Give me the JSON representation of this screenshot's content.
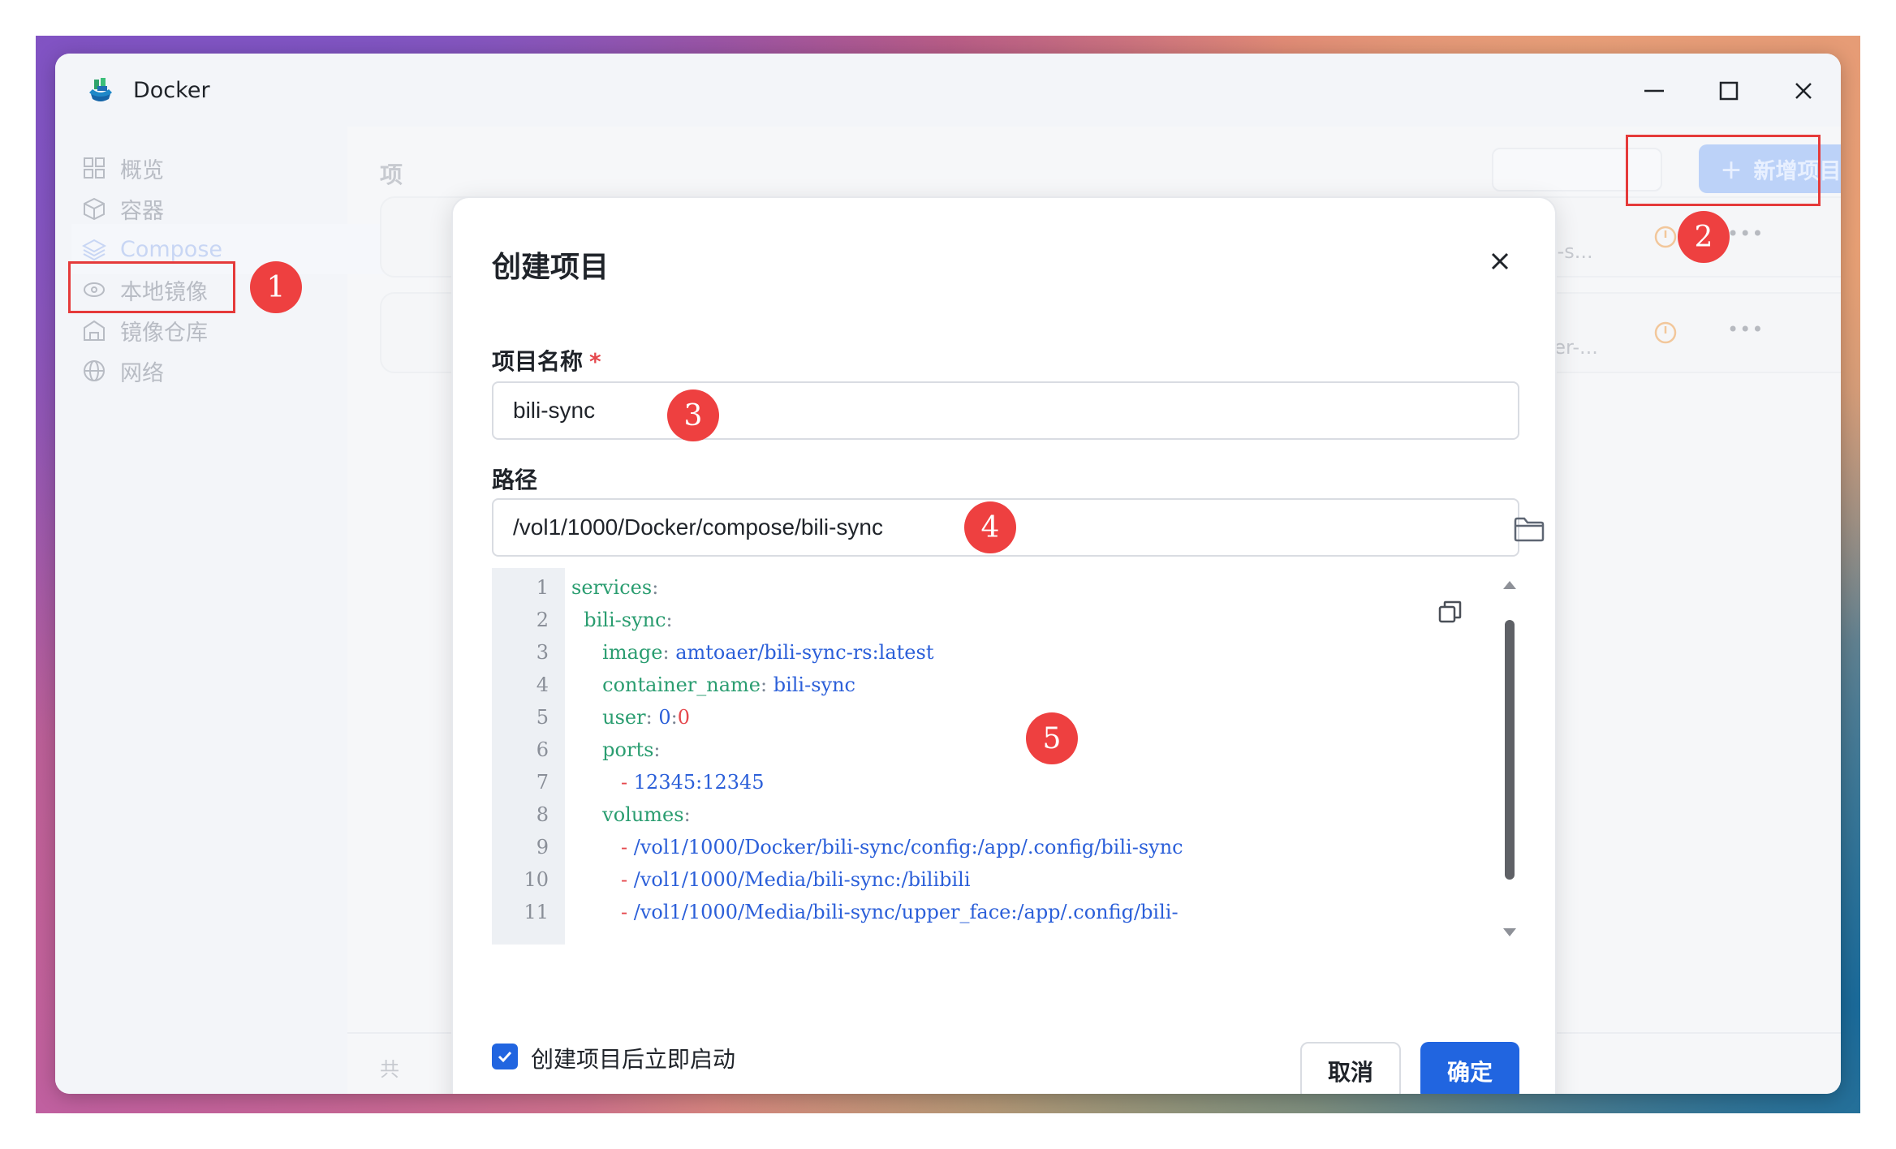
{
  "app": {
    "title": "Docker"
  },
  "sidebar": {
    "items": [
      {
        "label": "概览",
        "icon": "grid-icon"
      },
      {
        "label": "容器",
        "icon": "cube-icon"
      },
      {
        "label": "Compose",
        "icon": "layers-icon",
        "active": true
      },
      {
        "label": "本地镜像",
        "icon": "disk-icon"
      },
      {
        "label": "镜像仓库",
        "icon": "warehouse-icon"
      },
      {
        "label": "网络",
        "icon": "globe-icon"
      }
    ]
  },
  "background": {
    "section_title_fragment": "项",
    "add_button_label": "新增项目",
    "card1_path_fragment": "se/bili-s...",
    "card2_path_fragment": "/docker-...",
    "footer_fragment": "共"
  },
  "annotations": {
    "b1": "1",
    "b2": "2",
    "b3": "3",
    "b4": "4",
    "b5": "5"
  },
  "dialog": {
    "title": "创建项目",
    "name_label": "项目名称",
    "required_mark": "*",
    "name_value": "bili-sync",
    "path_label": "路径",
    "path_value": "/vol1/1000/Docker/compose/bili-sync",
    "autostart_label": "创建项目后立即启动",
    "autostart_checked": true,
    "cancel_label": "取消",
    "ok_label": "确定"
  },
  "editor": {
    "lines": [
      {
        "n": "1",
        "indent": "",
        "key": "services",
        "sep": ":",
        "val": ""
      },
      {
        "n": "2",
        "indent": "  ",
        "key": "bili-sync",
        "sep": ":",
        "val": ""
      },
      {
        "n": "3",
        "indent": "     ",
        "key": "image",
        "sep": ": ",
        "val": "amtoaer/bili-sync-rs:latest"
      },
      {
        "n": "4",
        "indent": "     ",
        "key": "container_name",
        "sep": ": ",
        "val": "bili-sync"
      },
      {
        "n": "5",
        "indent": "     ",
        "key": "user",
        "sep": ": ",
        "val": "0:0"
      },
      {
        "n": "6",
        "indent": "     ",
        "key": "ports",
        "sep": ":",
        "val": ""
      },
      {
        "n": "7",
        "indent": "        ",
        "key": "",
        "sep": "- ",
        "val": "12345:12345"
      },
      {
        "n": "8",
        "indent": "     ",
        "key": "volumes",
        "sep": ":",
        "val": ""
      },
      {
        "n": "9",
        "indent": "        ",
        "key": "",
        "sep": "- ",
        "val": "/vol1/1000/Docker/bili-sync/config:/app/.config/bili-sync"
      },
      {
        "n": "10",
        "indent": "        ",
        "key": "",
        "sep": "- ",
        "val": "/vol1/1000/Media/bili-sync:/bilibili"
      },
      {
        "n": "11",
        "indent": "        ",
        "key": "",
        "sep": "- ",
        "val": "/vol1/1000/Media/bili-sync/upper_face:/app/.config/bili-"
      }
    ]
  },
  "colors": {
    "primary": "#2165e0",
    "annotation_red": "#ee4040",
    "yaml_key": "#2a9d70",
    "yaml_value": "#2b5fd9"
  }
}
